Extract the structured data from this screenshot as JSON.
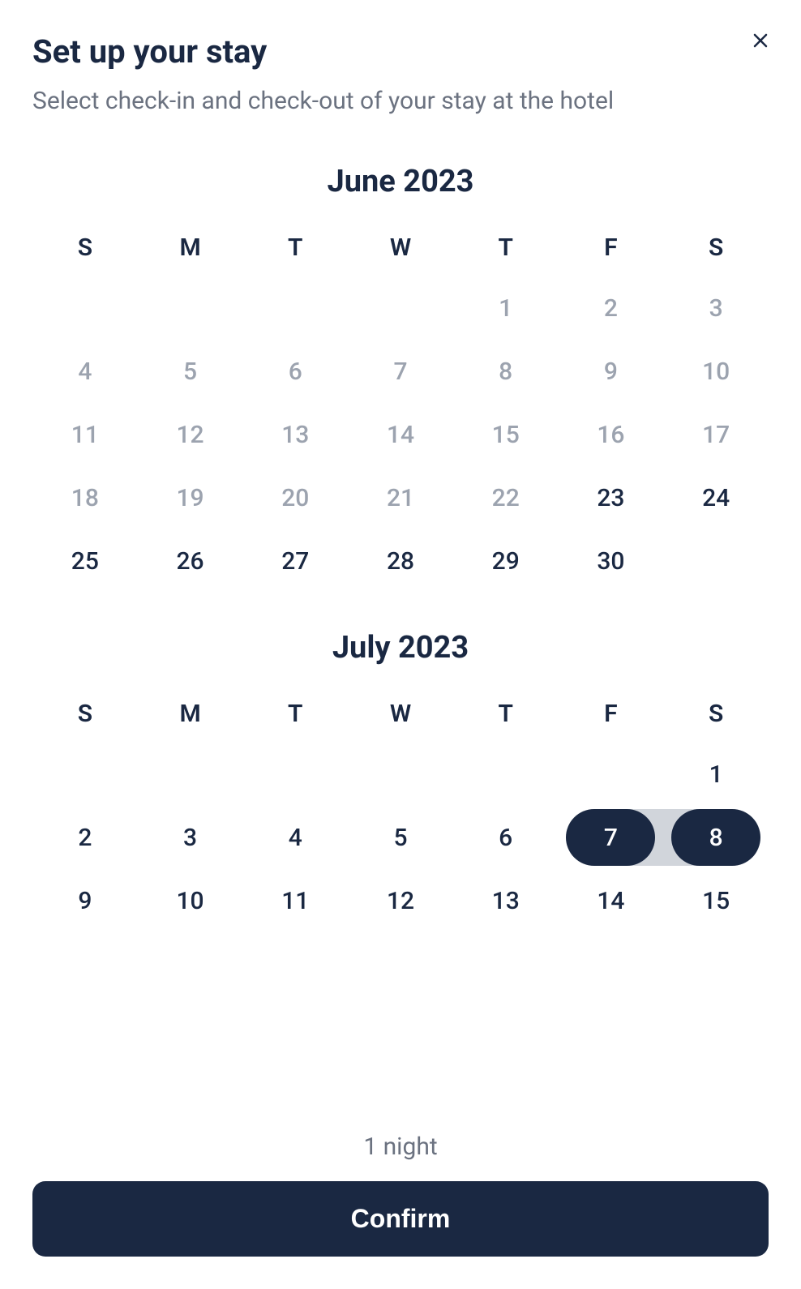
{
  "header": {
    "title": "Set up your stay",
    "subtitle": "Select check-in and check-out of your stay at the hotel"
  },
  "weekdays": [
    "S",
    "M",
    "T",
    "W",
    "T",
    "F",
    "S"
  ],
  "months": [
    {
      "title": "June 2023",
      "startOffset": 4,
      "days": [
        {
          "n": 1,
          "state": "disabled"
        },
        {
          "n": 2,
          "state": "disabled"
        },
        {
          "n": 3,
          "state": "disabled"
        },
        {
          "n": 4,
          "state": "disabled"
        },
        {
          "n": 5,
          "state": "disabled"
        },
        {
          "n": 6,
          "state": "disabled"
        },
        {
          "n": 7,
          "state": "disabled"
        },
        {
          "n": 8,
          "state": "disabled"
        },
        {
          "n": 9,
          "state": "disabled"
        },
        {
          "n": 10,
          "state": "disabled"
        },
        {
          "n": 11,
          "state": "disabled"
        },
        {
          "n": 12,
          "state": "disabled"
        },
        {
          "n": 13,
          "state": "disabled"
        },
        {
          "n": 14,
          "state": "disabled"
        },
        {
          "n": 15,
          "state": "disabled"
        },
        {
          "n": 16,
          "state": "disabled"
        },
        {
          "n": 17,
          "state": "disabled"
        },
        {
          "n": 18,
          "state": "disabled"
        },
        {
          "n": 19,
          "state": "disabled"
        },
        {
          "n": 20,
          "state": "disabled"
        },
        {
          "n": 21,
          "state": "disabled"
        },
        {
          "n": 22,
          "state": "disabled"
        },
        {
          "n": 23,
          "state": "normal"
        },
        {
          "n": 24,
          "state": "normal"
        },
        {
          "n": 25,
          "state": "normal"
        },
        {
          "n": 26,
          "state": "normal"
        },
        {
          "n": 27,
          "state": "normal"
        },
        {
          "n": 28,
          "state": "normal"
        },
        {
          "n": 29,
          "state": "normal"
        },
        {
          "n": 30,
          "state": "normal"
        }
      ]
    },
    {
      "title": "July 2023",
      "startOffset": 6,
      "days": [
        {
          "n": 1,
          "state": "normal"
        },
        {
          "n": 2,
          "state": "normal"
        },
        {
          "n": 3,
          "state": "normal"
        },
        {
          "n": 4,
          "state": "normal"
        },
        {
          "n": 5,
          "state": "normal"
        },
        {
          "n": 6,
          "state": "normal"
        },
        {
          "n": 7,
          "state": "selected-start"
        },
        {
          "n": 8,
          "state": "selected-end"
        },
        {
          "n": 9,
          "state": "normal"
        },
        {
          "n": 10,
          "state": "normal"
        },
        {
          "n": 11,
          "state": "normal"
        },
        {
          "n": 12,
          "state": "normal"
        },
        {
          "n": 13,
          "state": "normal"
        },
        {
          "n": 14,
          "state": "normal"
        },
        {
          "n": 15,
          "state": "normal"
        }
      ]
    }
  ],
  "footer": {
    "nights_label": "1 night",
    "confirm_label": "Confirm"
  }
}
